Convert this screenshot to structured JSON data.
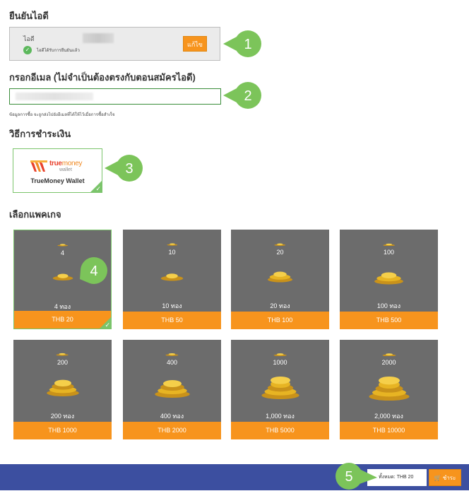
{
  "sections": {
    "verify_id": "ยืนยันไอดี",
    "email": "กรอกอีเมล (ไม่จำเป็นต้องตรงกับตอนสมัครไอดี)",
    "payment_method": "วิธีการชำระเงิน",
    "package": "เลือกแพคเกจ"
  },
  "id_box": {
    "label": "ไอดี",
    "verified_text": "ไอดีได้รับการยืนยันแล้ว",
    "edit_button": "แก้ไข"
  },
  "email_hint": "ข้อมูลการซื้อ จะถูกส่งไปยังอีเมลที่ได้ให้ไว้เมื่อการซื้อสำเร็จ",
  "payment": {
    "brand_true": "true",
    "brand_money": "money",
    "brand_wallet": "wallet",
    "name": "TrueMoney Wallet"
  },
  "packages": [
    {
      "amount": "4",
      "label": "4 ทอง",
      "price": "THB 20"
    },
    {
      "amount": "10",
      "label": "10 ทอง",
      "price": "THB 50"
    },
    {
      "amount": "20",
      "label": "20 ทอง",
      "price": "THB 100"
    },
    {
      "amount": "100",
      "label": "100 ทอง",
      "price": "THB 500"
    },
    {
      "amount": "200",
      "label": "200 ทอง",
      "price": "THB 1000"
    },
    {
      "amount": "400",
      "label": "400 ทอง",
      "price": "THB 2000"
    },
    {
      "amount": "1000",
      "label": "1,000 ทอง",
      "price": "THB 5000"
    },
    {
      "amount": "2000",
      "label": "2,000 ทอง",
      "price": "THB 10000"
    }
  ],
  "footer": {
    "total": "ทั้งหมด: THB 20",
    "pay_button": "ชำระ"
  },
  "callouts": [
    "1",
    "2",
    "3",
    "4",
    "5"
  ],
  "colors": {
    "accent": "#f7941d",
    "callout_green": "#7cc45a",
    "selected_border": "#7bc46b",
    "footer_bar": "#3c4fa0"
  }
}
